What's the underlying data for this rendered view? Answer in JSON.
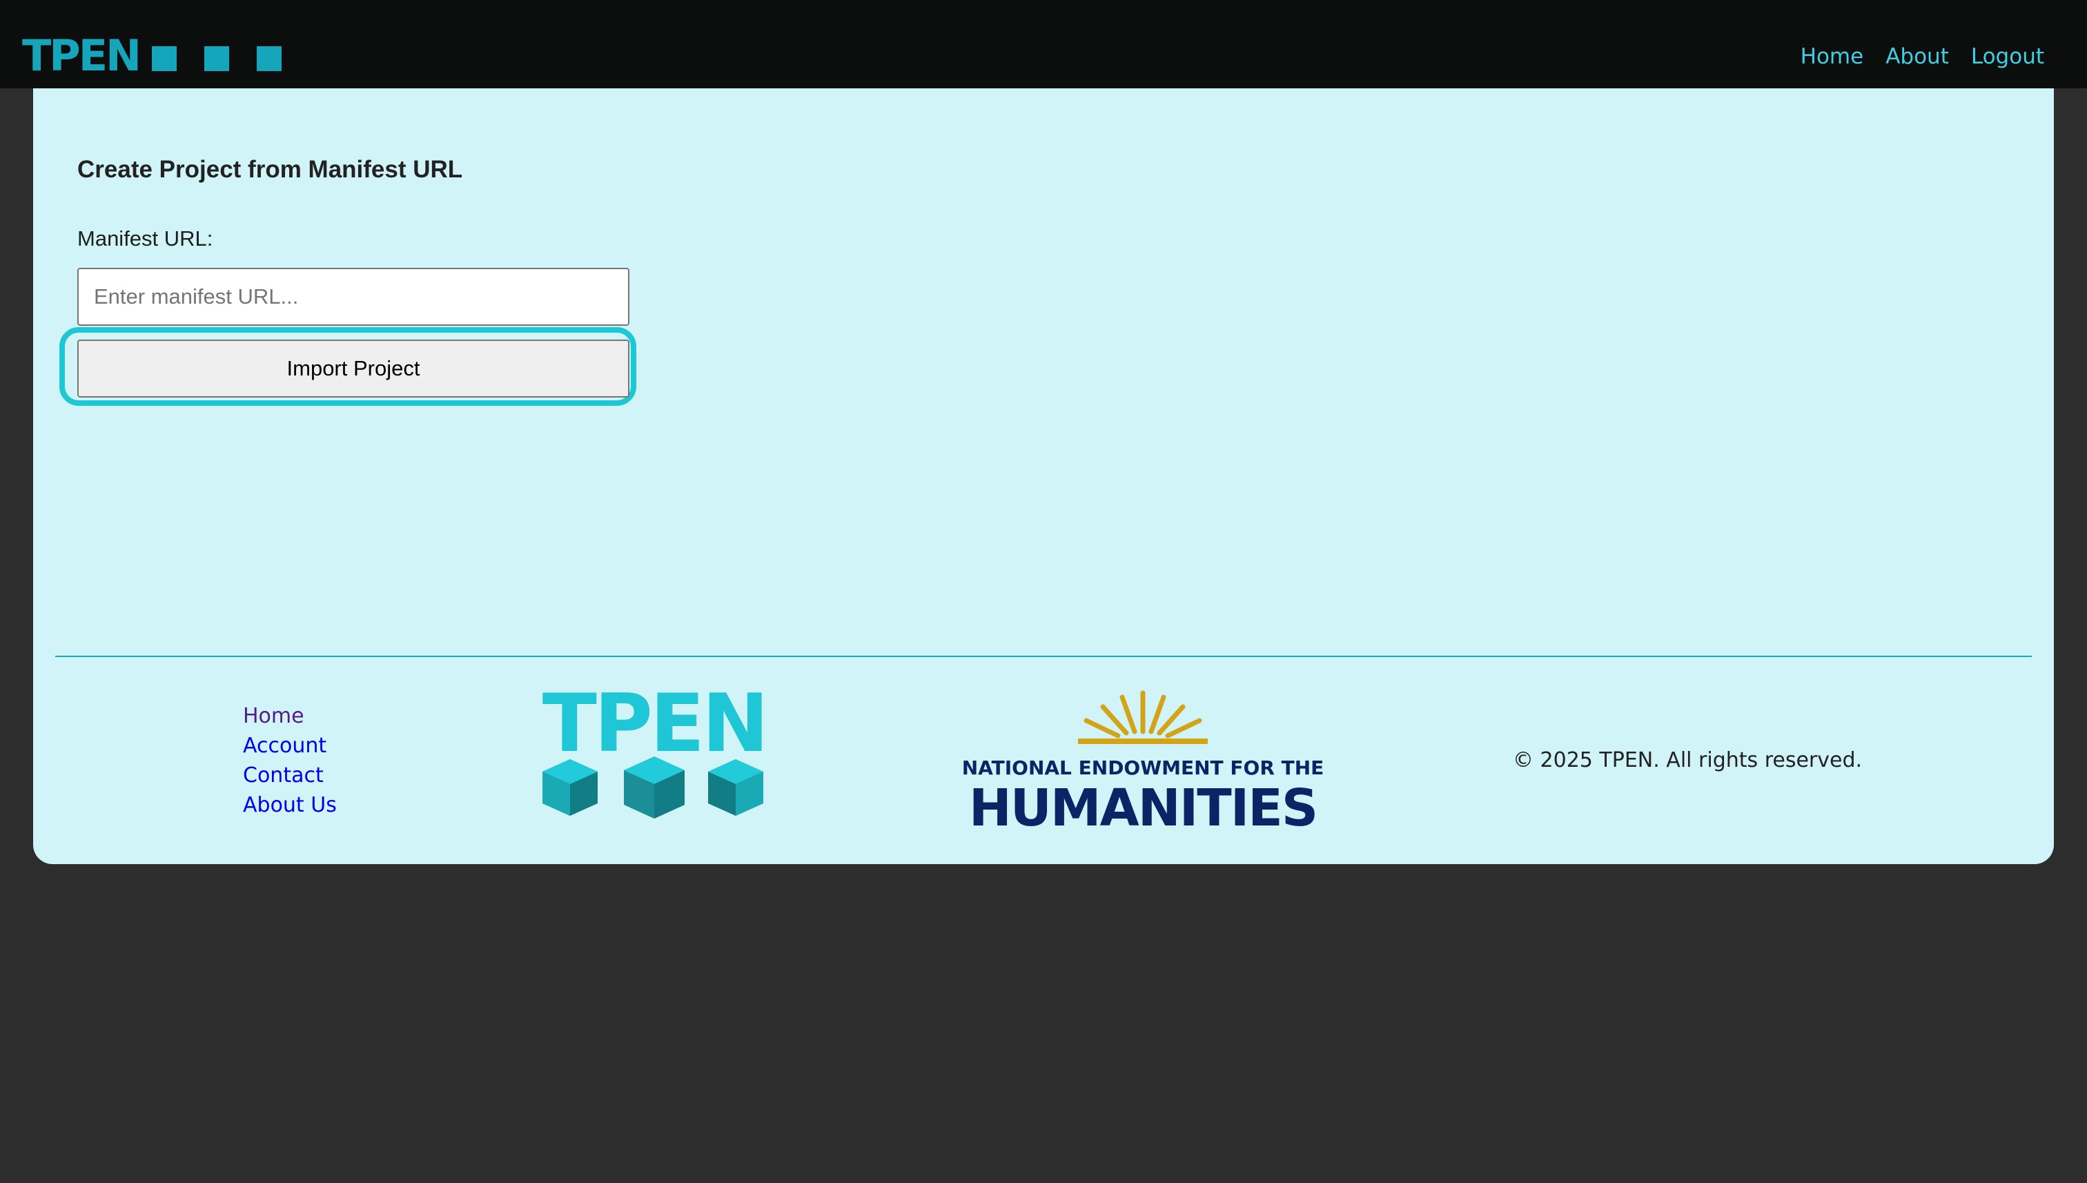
{
  "header": {
    "brand": "TPEN",
    "nav": [
      {
        "label": "Home"
      },
      {
        "label": "About"
      },
      {
        "label": "Logout"
      }
    ]
  },
  "main": {
    "title": "Create Project from Manifest URL",
    "manifest_label": "Manifest URL:",
    "manifest_value": "",
    "manifest_placeholder": "Enter manifest URL...",
    "import_button": "Import Project"
  },
  "footer": {
    "links": [
      {
        "label": "Home"
      },
      {
        "label": "Account"
      },
      {
        "label": "Contact"
      },
      {
        "label": "About Us"
      }
    ],
    "tpen_logo_text": "TPEN",
    "neh_logo": {
      "line1": "NATIONAL ENDOWMENT FOR THE",
      "line2": "HUMANITIES"
    },
    "copyright": "© 2025 TPEN. All rights reserved."
  },
  "colors": {
    "header_bg": "#0c0d0d",
    "brand": "#16a6bb",
    "nav_link": "#3fd0e2",
    "card_bg": "#d1f4f9",
    "page_bg": "#2d2d2d",
    "focus_ring": "#1ec8d3",
    "neh_navy": "#0a2466",
    "neh_gold": "#d4a418"
  }
}
